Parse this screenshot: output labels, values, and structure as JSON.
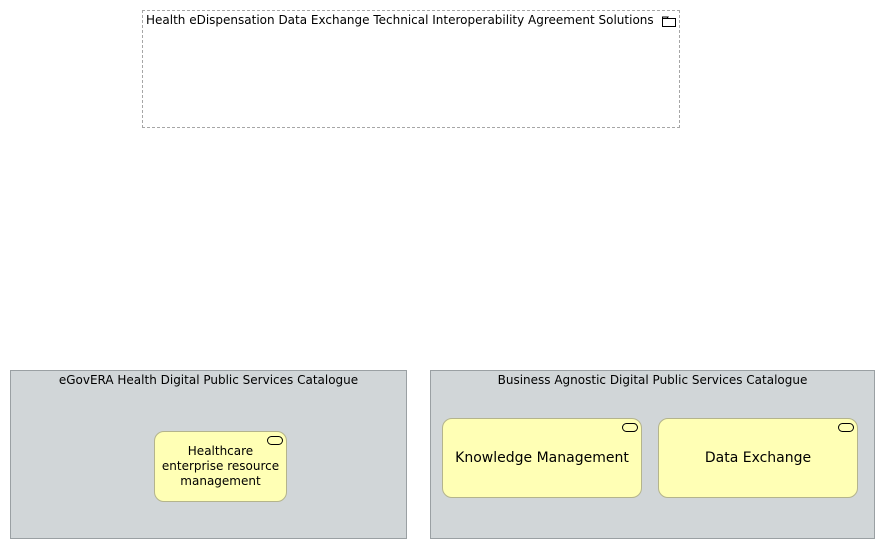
{
  "grouping": {
    "title": "Health eDispensation Data Exchange Technical Interoperability Agreement Solutions",
    "icon": "folder-icon"
  },
  "catalogues": {
    "left": {
      "title": "eGovERA Health Digital Public Services Catalogue",
      "services": [
        {
          "label": "Healthcare enterprise resource management",
          "icon": "service-icon"
        }
      ]
    },
    "right": {
      "title": "Business Agnostic Digital Public Services Catalogue",
      "services": [
        {
          "label": "Knowledge Management",
          "icon": "service-icon"
        },
        {
          "label": "Data Exchange",
          "icon": "service-icon"
        }
      ]
    }
  },
  "colors": {
    "service_fill": "#ffffb5",
    "catalogue_fill": "#d1d6d8",
    "grouping_border": "#a6a6a6"
  }
}
